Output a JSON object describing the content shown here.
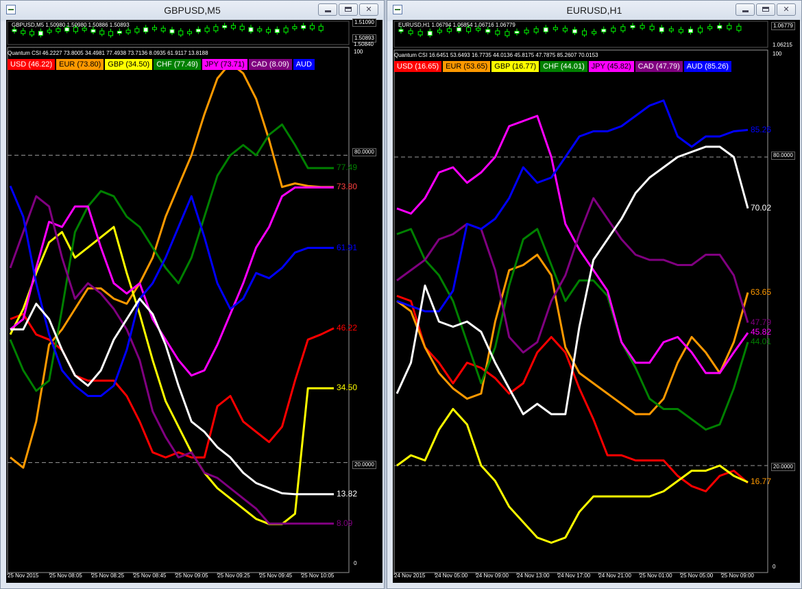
{
  "windows": [
    {
      "title": "GBPUSD,M5",
      "symbol_line": "GBPUSD,M5  1.50980 1.50980 1.50886 1.50893",
      "price_ticks": [
        "1.51090",
        "1.50893",
        "1.50840"
      ],
      "indicator_line": "Quantum CSI 46.2227 73.8005 34.4981 77.4938 73.7136 8.0935 61.9117 13.8188",
      "legend": [
        {
          "label": "USD (46.22)",
          "color": "#ff0000"
        },
        {
          "label": "EUR (73.80)",
          "color": "#ff9900"
        },
        {
          "label": "GBP (34.50)",
          "color": "#ffff00"
        },
        {
          "label": "CHF (77.49)",
          "color": "#008000"
        },
        {
          "label": "JPY (73.71)",
          "color": "#ff00ff"
        },
        {
          "label": "CAD (8.09)",
          "color": "#800080"
        },
        {
          "label": "AUD",
          "color": "#0000ff"
        }
      ],
      "scale": {
        "top": "100",
        "upper": "80.0000",
        "lower": "20.0000",
        "bottom": "0"
      },
      "time_labels": [
        "25 Nov 2015",
        "25 Nov 08:05",
        "25 Nov 08:25",
        "25 Nov 08:45",
        "25 Nov 09:05",
        "25 Nov 09:25",
        "25 Nov 09:45",
        "25 Nov 10:05"
      ],
      "end_labels": [
        {
          "text": "77.49",
          "color": "#008000",
          "y": 77.49
        },
        {
          "text": "73.80",
          "color": "#ff4040",
          "y": 73.8
        },
        {
          "text": "61.91",
          "color": "#0000ff",
          "y": 61.91
        },
        {
          "text": "46.22",
          "color": "#ff0000",
          "y": 46.22
        },
        {
          "text": "34.50",
          "color": "#ffff00",
          "y": 34.5
        },
        {
          "text": "13.82",
          "color": "#ffffff",
          "y": 13.82
        },
        {
          "text": "8.09",
          "color": "#800080",
          "y": 8.09
        }
      ],
      "chart_data": {
        "type": "line",
        "ylim": [
          0,
          100
        ],
        "series": [
          {
            "name": "USD",
            "color": "#ff0000",
            "values": [
              48,
              49,
              45,
              44,
              42,
              37,
              36,
              36,
              36,
              33,
              28,
              22,
              21,
              22,
              21,
              21,
              31,
              33,
              28,
              26,
              24,
              27,
              36,
              44,
              45,
              46.22
            ]
          },
          {
            "name": "EUR",
            "color": "#ff9900",
            "values": [
              21,
              19,
              28,
              43,
              46,
              50,
              54,
              54,
              52,
              51,
              55,
              60,
              68,
              74,
              80,
              88,
              95,
              98,
              96,
              91,
              83,
              73.8,
              74.5,
              74,
              73.8,
              73.8
            ]
          },
          {
            "name": "GBP",
            "color": "#ffff00",
            "values": [
              45,
              50,
              57,
              63,
              65,
              60,
              62,
              64,
              66,
              57,
              49,
              40,
              32,
              27,
              22,
              18,
              15,
              13,
              11,
              9,
              8,
              8,
              10,
              34.5,
              34.5,
              34.5
            ]
          },
          {
            "name": "CHF",
            "color": "#008000",
            "values": [
              44,
              38,
              34,
              36,
              50,
              65,
              70,
              73,
              72,
              68,
              66,
              62,
              58,
              55,
              60,
              68,
              76,
              80,
              82,
              80,
              84,
              86,
              82,
              77.49,
              77.49,
              77.49
            ]
          },
          {
            "name": "JPY",
            "color": "#ff00ff",
            "values": [
              46,
              48,
              58,
              67,
              66,
              70,
              70,
              62,
              55,
              53,
              55,
              48,
              44,
              40,
              37,
              38,
              43,
              49,
              55,
              62,
              66,
              72,
              73.71,
              73.71,
              73.71,
              73.71
            ]
          },
          {
            "name": "CAD",
            "color": "#800080",
            "values": [
              58,
              65,
              72,
              70,
              60,
              52,
              55,
              53,
              50,
              46,
              40,
              30,
              25,
              21,
              22,
              18,
              17,
              15,
              13,
              11,
              8.09,
              8.09,
              8.09,
              8.09,
              8.09,
              8.09
            ]
          },
          {
            "name": "AUD",
            "color": "#0000ff",
            "values": [
              74,
              68,
              55,
              45,
              38,
              35,
              33,
              33,
              35,
              42,
              52,
              55,
              60,
              66,
              72,
              64,
              55,
              50,
              52,
              57,
              56,
              58,
              61,
              61.91,
              61.91,
              61.91
            ]
          },
          {
            "name": "",
            "color": "#ffffff",
            "values": [
              46,
              46,
              51,
              48,
              42,
              37,
              35,
              38,
              44,
              48,
              52,
              49,
              43,
              35,
              28,
              26,
              23,
              21,
              18,
              16,
              15,
              14,
              13.82,
              13.82,
              13.82,
              13.82
            ]
          }
        ]
      }
    },
    {
      "title": "EURUSD,H1",
      "symbol_line": "EURUSD,H1  1.06794 1.06854 1.06716 1.06779",
      "price_ticks": [
        "1.06779",
        "1.06215"
      ],
      "indicator_line": "Quantum CSI 16.6451 53.6493 16.7735 44.0136 45.8175 47.7875 85.2607 70.0153",
      "legend": [
        {
          "label": "USD (16.65)",
          "color": "#ff0000"
        },
        {
          "label": "EUR (53.65)",
          "color": "#ff9900"
        },
        {
          "label": "GBP (16.77)",
          "color": "#ffff00"
        },
        {
          "label": "CHF (44.01)",
          "color": "#008000"
        },
        {
          "label": "JPY (45.82)",
          "color": "#ff00ff"
        },
        {
          "label": "CAD (47.79)",
          "color": "#800080"
        },
        {
          "label": "AUD (85.26)",
          "color": "#0000ff"
        }
      ],
      "scale": {
        "top": "100",
        "upper": "80.0000",
        "lower": "20.0000",
        "bottom": "0"
      },
      "time_labels": [
        "24 Nov 2015",
        "24 Nov 05:00",
        "24 Nov 09:00",
        "24 Nov 13:00",
        "24 Nov 17:00",
        "24 Nov 21:00",
        "25 Nov 01:00",
        "25 Nov 05:00",
        "25 Nov 09:00"
      ],
      "end_labels": [
        {
          "text": "85.26",
          "color": "#0000ff",
          "y": 85.26
        },
        {
          "text": "70.02",
          "color": "#ffffff",
          "y": 70.02
        },
        {
          "text": "63.65",
          "color": "#ff9900",
          "y": 53.65
        },
        {
          "text": "47.79",
          "color": "#800080",
          "y": 47.79
        },
        {
          "text": "45.82",
          "color": "#ff00ff",
          "y": 45.82
        },
        {
          "text": "44.01",
          "color": "#008000",
          "y": 44.01
        },
        {
          "text": "16.77",
          "color": "#ff9900",
          "y": 16.77
        }
      ],
      "chart_data": {
        "type": "line",
        "ylim": [
          0,
          100
        ],
        "series": [
          {
            "name": "USD",
            "color": "#ff0000",
            "values": [
              53,
              52,
              43,
              40,
              36,
              40,
              39,
              37,
              34,
              36,
              42,
              45,
              42,
              35,
              29,
              22,
              22,
              21,
              21,
              21,
              18,
              16,
              15,
              18,
              19,
              16.65
            ]
          },
          {
            "name": "EUR",
            "color": "#ff9900",
            "values": [
              52,
              50,
              43,
              38,
              35,
              33,
              34,
              48,
              58,
              59,
              61,
              57,
              43,
              38,
              36,
              34,
              32,
              30,
              30,
              33,
              40,
              45,
              42,
              38,
              44,
              53.65
            ]
          },
          {
            "name": "GBP",
            "color": "#ffff00",
            "values": [
              20,
              22,
              21,
              27,
              31,
              28,
              20,
              17,
              12,
              9,
              6,
              5,
              6,
              11,
              14,
              14,
              14,
              14,
              14,
              15,
              17,
              19,
              19,
              20,
              18,
              16.77
            ]
          },
          {
            "name": "CHF",
            "color": "#008000",
            "values": [
              65,
              66,
              60,
              57,
              52,
              44,
              36,
              43,
              55,
              64,
              66,
              59,
              52,
              56,
              56,
              53,
              44,
              39,
              33,
              31,
              31,
              29,
              27,
              28,
              35,
              44.01
            ]
          },
          {
            "name": "JPY",
            "color": "#ff00ff",
            "values": [
              70,
              69,
              72,
              77,
              78,
              75,
              77,
              80,
              86,
              87,
              88,
              80,
              67,
              62,
              58,
              54,
              44,
              40,
              40,
              44,
              45,
              42,
              38,
              38,
              42,
              45.82
            ]
          },
          {
            "name": "CAD",
            "color": "#800080",
            "values": [
              56,
              58,
              60,
              64,
              65,
              67,
              66,
              58,
              45,
              42,
              44,
              52,
              57,
              65,
              72,
              68,
              64,
              61,
              60,
              60,
              59,
              59,
              61,
              61,
              57,
              47.79
            ]
          },
          {
            "name": "AUD",
            "color": "#0000ff",
            "values": [
              52,
              51,
              50,
              50,
              54,
              67,
              66,
              68,
              72,
              78,
              75,
              76,
              80,
              84,
              85,
              85,
              86,
              88,
              90,
              91,
              84,
              82,
              84,
              84,
              85,
              85.26
            ]
          },
          {
            "name": "",
            "color": "#ffffff",
            "values": [
              34,
              40,
              55,
              48,
              47,
              48,
              46,
              40,
              35,
              30,
              32,
              30,
              30,
              47,
              60,
              64,
              68,
              73,
              76,
              78,
              80,
              81,
              82,
              82,
              80,
              70.02
            ]
          }
        ]
      }
    }
  ]
}
